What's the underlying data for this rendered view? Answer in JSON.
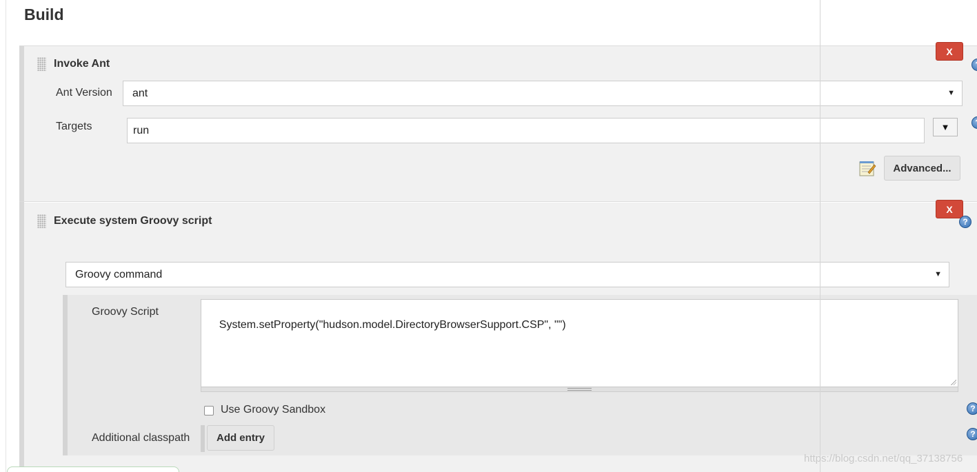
{
  "section": {
    "title": "Build"
  },
  "invoke_ant": {
    "title": "Invoke Ant",
    "delete_label": "X",
    "ant_version_label": "Ant Version",
    "ant_version_value": "ant",
    "targets_label": "Targets",
    "targets_value": "run",
    "expand_label": "▼",
    "advanced_label": "Advanced..."
  },
  "groovy_step": {
    "title": "Execute system Groovy script",
    "delete_label": "X",
    "command_select_value": "Groovy command",
    "script_label": "Groovy Script",
    "script_value": "System.setProperty(\"hudson.model.DirectoryBrowserSupport.CSP\", \"\")",
    "sandbox_label": "Use Groovy Sandbox",
    "sandbox_checked": false,
    "classpath_label": "Additional classpath",
    "add_entry_label": "Add entry"
  },
  "icons": {
    "help": "help-icon",
    "drag": "drag-handle-icon",
    "notepad": "notepad-icon",
    "caret": "chevron-down-icon"
  },
  "colors": {
    "delete_button": "#d24939",
    "help_icon": "#2f6db3",
    "panel_background": "#f1f1f1"
  },
  "watermark": "https://blog.csdn.net/qq_37138756"
}
